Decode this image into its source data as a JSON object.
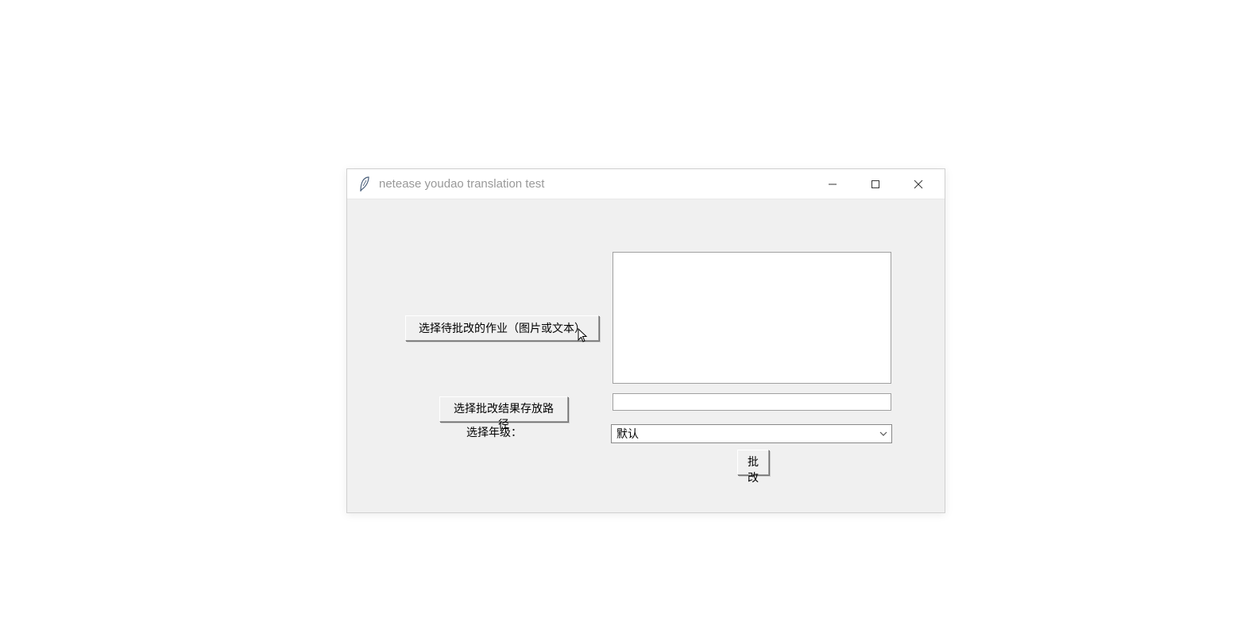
{
  "window": {
    "title": "netease youdao translation test"
  },
  "buttons": {
    "select_homework": "选择待批改的作业（图片或文本）",
    "select_result_path": "选择批改结果存放路径",
    "process": "批改"
  },
  "labels": {
    "grade": "选择年级："
  },
  "fields": {
    "homework_text": "",
    "result_path": ""
  },
  "combobox": {
    "selected": "默认"
  }
}
